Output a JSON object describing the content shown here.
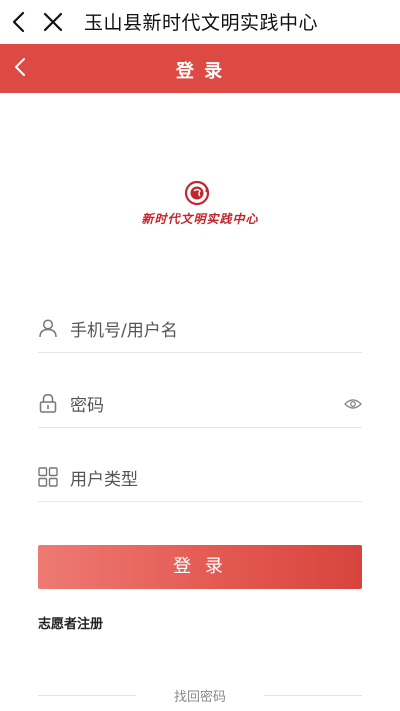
{
  "topbar": {
    "back_icon": "chevron-left-icon",
    "close_icon": "close-icon",
    "title": "玉山县新时代文明实践中心"
  },
  "header": {
    "back_icon": "chevron-left-icon",
    "title": "登 录"
  },
  "logo": {
    "emblem_icon": "logo-emblem",
    "text": "新时代文明实践中心",
    "color": "#c0262c"
  },
  "form": {
    "username": {
      "icon": "user-icon",
      "placeholder": "手机号/用户名"
    },
    "password": {
      "icon": "lock-icon",
      "placeholder": "密码",
      "toggle_icon": "eye-icon"
    },
    "user_type": {
      "icon": "grid-icon",
      "placeholder": "用户类型"
    }
  },
  "buttons": {
    "login": "登 录",
    "register": "志愿者注册",
    "forgot": "找回密码"
  },
  "colors": {
    "accent": "#dd4a43",
    "button_start": "#ee7a74",
    "button_end": "#d7443d"
  }
}
